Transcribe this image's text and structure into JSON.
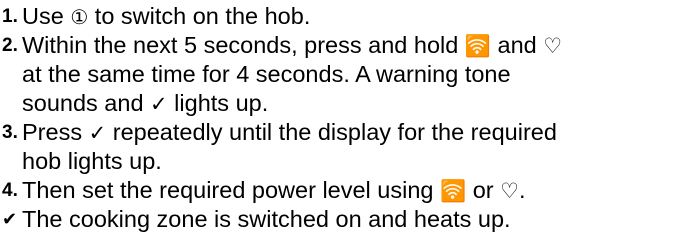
{
  "steps": [
    {
      "number": "1.",
      "text_a": "Use ",
      "text_b": " to switch on the hob."
    },
    {
      "number": "2.",
      "line1_a": "Within the next 5 seconds, press and hold ",
      "line1_b": " and ",
      "line2": "at the same time for 4 seconds. A warning tone",
      "line3_a": "sounds and ",
      "line3_b": " lights up."
    },
    {
      "number": "3.",
      "line1_a": "Press ",
      "line1_b": " repeatedly until the display for the required",
      "line2": "hob lights up."
    },
    {
      "number": "4.",
      "text_a": "Then set the required power level using ",
      "text_b": " or ",
      "text_c": "."
    }
  ],
  "result": {
    "marker": "✔",
    "text": "The cooking zone is switched on and heats up."
  },
  "symbols": {
    "power": "⏀",
    "increase": "ᯤ",
    "decrease": "♡",
    "confirm": "✓"
  }
}
